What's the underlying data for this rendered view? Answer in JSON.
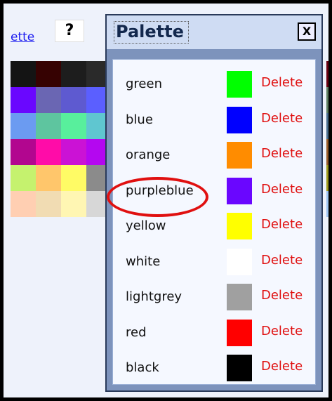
{
  "background": {
    "link_text": "ette",
    "help_label": "?",
    "swatches": [
      "#141414",
      "#360202",
      "#1d1d1d",
      "#2a2a2a",
      "#3a3a3a",
      "#6a07ff",
      "#6a66b3",
      "#5e5ad0",
      "#5b5fff",
      "#5d7fff",
      "#6b9bf1",
      "#5ec59f",
      "#58ef9c",
      "#5fc6d0",
      "#6fd8df",
      "#b2068f",
      "#ff0ca8",
      "#cb12d5",
      "#b407f0",
      "#c000ff",
      "#c5f26e",
      "#ffc66b",
      "#fffb65",
      "#8b8b8b",
      "#cbcbcb",
      "#ffcfb2",
      "#f1dcb3",
      "#fff6b3",
      "#d7d7d7",
      "#d8d8d8"
    ],
    "right_strip": [
      "#6b0011",
      "#5f7f63",
      "#4a6e8f",
      "#9b5d2a",
      "#a09a1c",
      "#9fc5f3"
    ]
  },
  "dialog": {
    "title": "Palette",
    "close_label": "X",
    "delete_label": "Delete",
    "items": [
      {
        "name": "green",
        "color": "#00ff00"
      },
      {
        "name": "blue",
        "color": "#0000ff"
      },
      {
        "name": "orange",
        "color": "#ff8c00"
      },
      {
        "name": "purpleblue",
        "color": "#6a06ff"
      },
      {
        "name": "yellow",
        "color": "#ffff00"
      },
      {
        "name": "white",
        "color": "#ffffff"
      },
      {
        "name": "lightgrey",
        "color": "#a0a0a0"
      },
      {
        "name": "red",
        "color": "#ff0000"
      },
      {
        "name": "black",
        "color": "#000000"
      }
    ]
  }
}
